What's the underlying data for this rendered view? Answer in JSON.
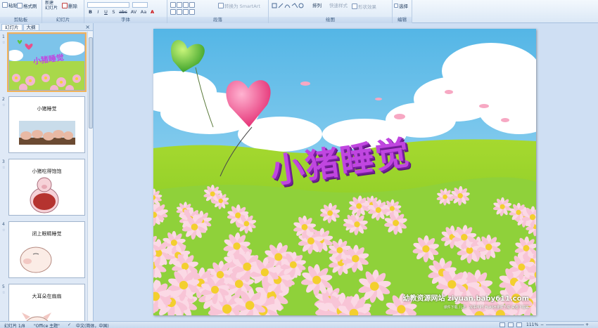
{
  "ribbon": {
    "paste": "粘贴",
    "format_painter": "格式刷",
    "new_slide": "新建\n幻灯片",
    "delete": "删除",
    "convert_smartart": "转换为 SmartArt",
    "arrange": "排列",
    "quick_styles": "快速样式",
    "shape_effects": "形状效果",
    "select": "选择",
    "groups": {
      "clipboard": "剪贴板",
      "slides": "幻灯片",
      "font": "字体",
      "paragraph": "段落",
      "drawing": "绘图",
      "editing": "编辑"
    },
    "font_buttons": [
      "B",
      "I",
      "U",
      "S",
      "abc",
      "AV",
      "Aa",
      "A"
    ]
  },
  "panel": {
    "tabs": [
      "幻灯片",
      "大纲"
    ],
    "close": "×",
    "thumbs": [
      {
        "num": "1",
        "title": "小猪睡觉"
      },
      {
        "num": "2",
        "title": "小猪睡觉"
      },
      {
        "num": "3",
        "title": "小猪吃得饱饱"
      },
      {
        "num": "4",
        "title": "闭上眼睛睡觉"
      },
      {
        "num": "5",
        "title": "大耳朵在扇扇"
      }
    ]
  },
  "slide": {
    "title": "小猪睡觉",
    "site": "幼教资源网站  ziyuan.baby611.com",
    "site_sub": "课件下载  儿歌、故事MP3  FLASH课件下载  试卷下载等"
  },
  "status": {
    "slide_info": "幻灯片 1/8",
    "theme": "\"Office 主题\"",
    "language": "中文(简体，中国)",
    "zoom": "111%"
  },
  "colors": {
    "ribbon_bg": "#dbe8f6",
    "title_purple": "#c046e0",
    "selected_outline": "#f2b35a"
  }
}
